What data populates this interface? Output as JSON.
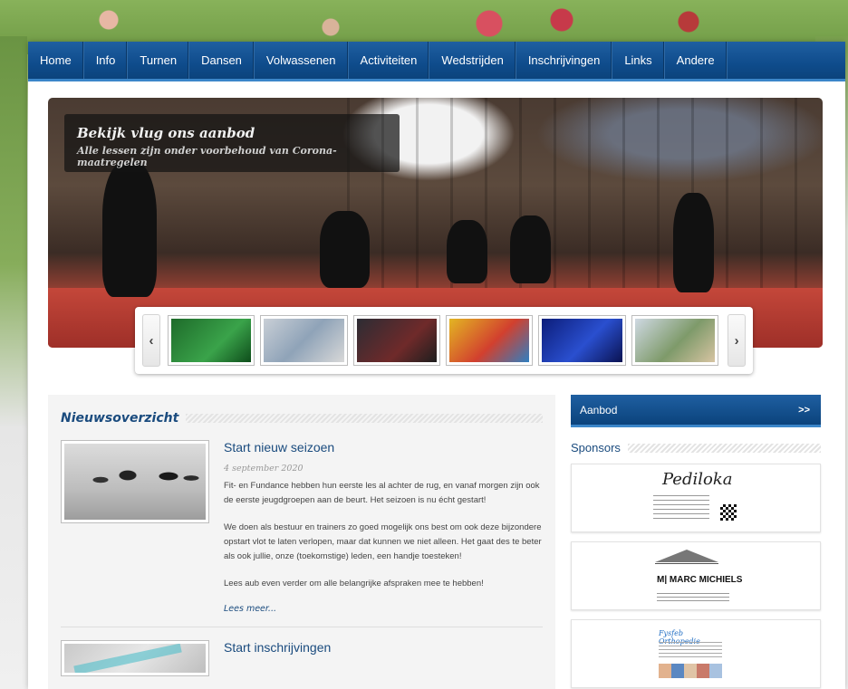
{
  "nav": {
    "items": [
      {
        "label": "Home"
      },
      {
        "label": "Info"
      },
      {
        "label": "Turnen"
      },
      {
        "label": "Dansen"
      },
      {
        "label": "Volwassenen"
      },
      {
        "label": "Activiteiten"
      },
      {
        "label": "Wedstrijden"
      },
      {
        "label": "Inschrijvingen"
      },
      {
        "label": "Links"
      },
      {
        "label": "Andere"
      }
    ]
  },
  "slider": {
    "title": "Bekijk vlug ons aanbod",
    "subtitle": "Alle lessen zijn onder voorbehoud van Corona-maatregelen",
    "prev_icon": "‹",
    "next_icon": "›",
    "thumb_count": 6
  },
  "news": {
    "heading": "Nieuwsoverzicht",
    "articles": [
      {
        "title": "Start nieuw seizoen",
        "date": "4 september 2020",
        "paragraphs": [
          "Fit- en Fundance hebben hun eerste les al achter de rug, en vanaf morgen zijn ook de eerste jeugdgroepen aan de beurt. Het seizoen is nu écht gestart!",
          "We doen als bestuur en trainers zo goed mogelijk ons best om ook deze bijzondere opstart vlot te laten verlopen, maar dat kunnen we niet alleen. Het gaat des te beter als ook jullie, onze (toekomstige) leden, een handje toesteken!",
          "Lees aub even verder om alle belangrijke afspraken mee te hebben!"
        ],
        "read_more": "Lees meer..."
      },
      {
        "title": "Start inschrijvingen"
      }
    ]
  },
  "aside": {
    "aanbod_label": "Aanbod",
    "aanbod_chevron": ">>",
    "sponsors_heading": "Sponsors",
    "sponsors": [
      {
        "name": "Pediloka"
      },
      {
        "name": "Marc Michiels"
      },
      {
        "name": "Fysfeb Orthopedie"
      }
    ]
  },
  "colors": {
    "nav_blue": "#0f4c8c",
    "heading_blue": "#1a4b7e",
    "accent_line": "#3b86c9"
  }
}
